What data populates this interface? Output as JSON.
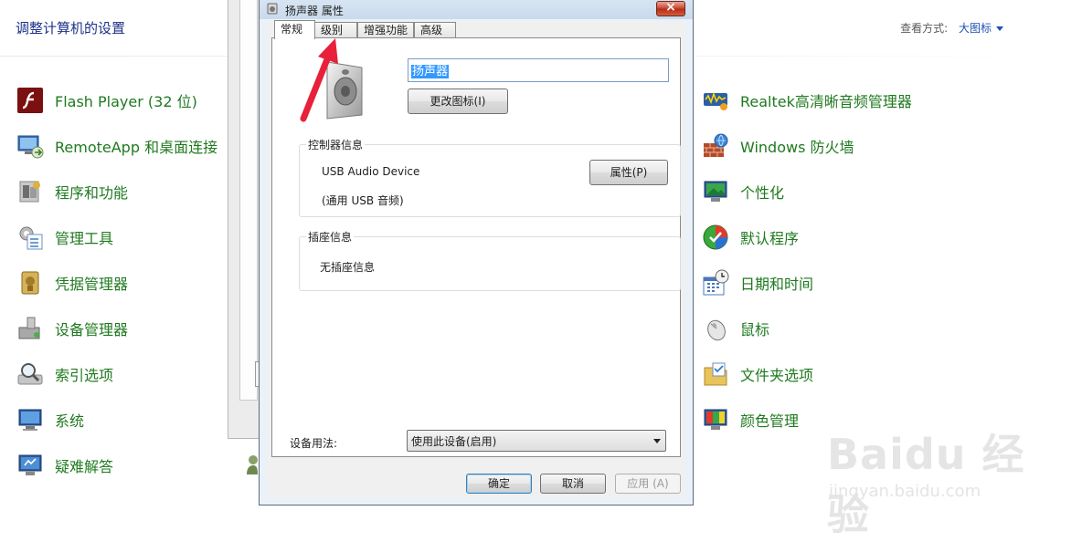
{
  "control_panel": {
    "title": "调整计算机的设置",
    "view_label": "查看方式:",
    "view_value": "大图标",
    "left_items": [
      {
        "label": "Flash Player (32 位)",
        "icon": "flash-icon"
      },
      {
        "label": "RemoteApp 和桌面连接",
        "icon": "remoteapp-icon"
      },
      {
        "label": "程序和功能",
        "icon": "programs-icon"
      },
      {
        "label": "管理工具",
        "icon": "admin-tools-icon"
      },
      {
        "label": "凭据管理器",
        "icon": "credential-icon"
      },
      {
        "label": "设备管理器",
        "icon": "device-manager-icon"
      },
      {
        "label": "索引选项",
        "icon": "index-icon"
      },
      {
        "label": "系统",
        "icon": "system-icon"
      },
      {
        "label": "疑难解答",
        "icon": "troubleshoot-icon"
      }
    ],
    "right_items": [
      {
        "label": "Realtek高清晰音频管理器",
        "icon": "realtek-icon"
      },
      {
        "label": "Windows 防火墙",
        "icon": "firewall-icon"
      },
      {
        "label": "个性化",
        "icon": "personalize-icon"
      },
      {
        "label": "默认程序",
        "icon": "default-programs-icon"
      },
      {
        "label": "日期和时间",
        "icon": "datetime-icon"
      },
      {
        "label": "鼠标",
        "icon": "mouse-icon"
      },
      {
        "label": "文件夹选项",
        "icon": "folder-options-icon"
      },
      {
        "label": "颜色管理",
        "icon": "color-management-icon"
      }
    ]
  },
  "dialog": {
    "title": "扬声器 属性",
    "tabs": [
      "常规",
      "级别",
      "增强功能",
      "高级"
    ],
    "active_tab": "常规",
    "device_name": "扬声器",
    "change_icon_label": "更改图标(I)",
    "controller_group_label": "控制器信息",
    "controller_device": "USB Audio Device",
    "controller_sub": "(通用 USB 音频)",
    "properties_label": "属性(P)",
    "jack_group_label": "插座信息",
    "jack_info": "无插座信息",
    "usage_label": "设备用法:",
    "usage_value": "使用此设备(启用)",
    "ok_label": "确定",
    "cancel_label": "取消",
    "apply_label": "应用 (A)"
  },
  "watermark": {
    "main": "Baidu 经验",
    "sub": "jingyan.baidu.com"
  },
  "colors": {
    "link_green": "#1f7a1f",
    "title_blue": "#1e3287",
    "annotation_red": "#e8203a",
    "selection_blue": "#3399ff"
  }
}
